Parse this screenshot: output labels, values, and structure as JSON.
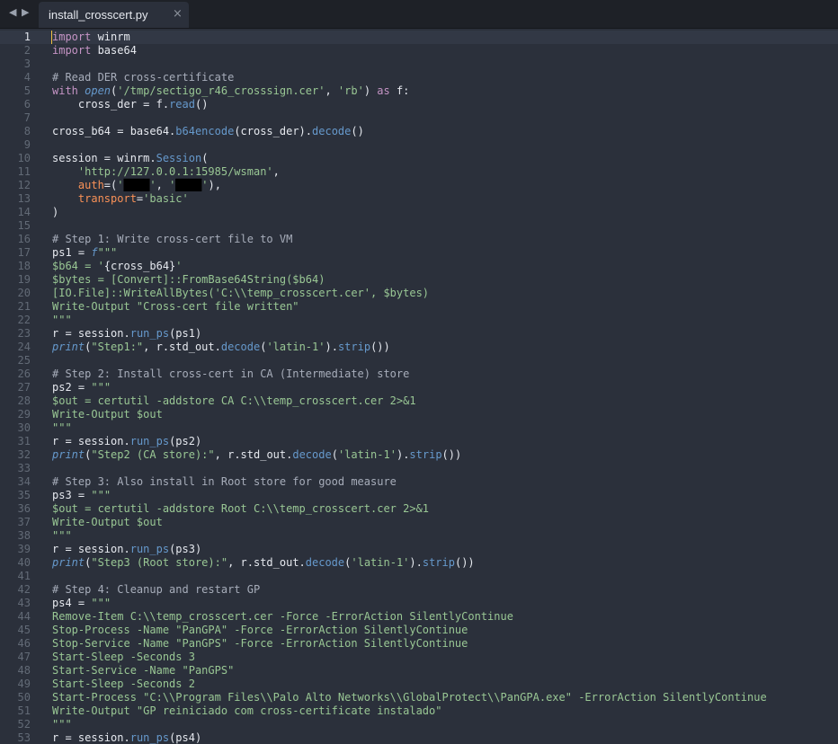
{
  "window": {
    "tab_title": "install_crosscert.py",
    "tab_close": "×",
    "nav_back": "◀",
    "nav_forward": "▶"
  },
  "editor": {
    "active_line": 1,
    "lines": [
      [
        [
          "k",
          "import"
        ],
        [
          "n",
          " winrm"
        ]
      ],
      [
        [
          "k",
          "import"
        ],
        [
          "n",
          " base64"
        ]
      ],
      [],
      [
        [
          "c",
          "# Read DER cross-certificate"
        ]
      ],
      [
        [
          "k",
          "with "
        ],
        [
          "b",
          "open"
        ],
        [
          "n",
          "("
        ],
        [
          "s",
          "'/tmp/sectigo_r46_crosssign.cer'"
        ],
        [
          "n",
          ", "
        ],
        [
          "s",
          "'rb'"
        ],
        [
          "n",
          ") "
        ],
        [
          "k",
          "as"
        ],
        [
          "n",
          " f:"
        ]
      ],
      [
        [
          "n",
          "    cross_der "
        ],
        [
          "o",
          "="
        ],
        [
          "n",
          " f."
        ],
        [
          "f",
          "read"
        ],
        [
          "n",
          "()"
        ]
      ],
      [],
      [
        [
          "n",
          "cross_b64 "
        ],
        [
          "o",
          "="
        ],
        [
          "n",
          " base64."
        ],
        [
          "f",
          "b64encode"
        ],
        [
          "n",
          "(cross_der)."
        ],
        [
          "f",
          "decode"
        ],
        [
          "n",
          "()"
        ]
      ],
      [],
      [
        [
          "n",
          "session "
        ],
        [
          "o",
          "="
        ],
        [
          "n",
          " winrm."
        ],
        [
          "f",
          "Session"
        ],
        [
          "n",
          "("
        ]
      ],
      [
        [
          "s",
          "    'http://127.0.0.1:15985/wsman'"
        ],
        [
          "n",
          ","
        ]
      ],
      [
        [
          "p",
          "    auth"
        ],
        [
          "o",
          "="
        ],
        [
          "n",
          "("
        ],
        [
          "s",
          "'"
        ],
        [
          "r",
          "████"
        ],
        [
          "s",
          "'"
        ],
        [
          "n",
          ", "
        ],
        [
          "s",
          "'"
        ],
        [
          "r",
          "████"
        ],
        [
          "s",
          "'"
        ],
        [
          "n",
          "),"
        ]
      ],
      [
        [
          "p",
          "    transport"
        ],
        [
          "o",
          "="
        ],
        [
          "s",
          "'basic'"
        ]
      ],
      [
        [
          "n",
          ")"
        ]
      ],
      [],
      [
        [
          "c",
          "# Step 1: Write cross-cert file to VM"
        ]
      ],
      [
        [
          "n",
          "ps1 "
        ],
        [
          "o",
          "="
        ],
        [
          "n",
          " "
        ],
        [
          "b",
          "f"
        ],
        [
          "s",
          "\"\"\""
        ]
      ],
      [
        [
          "s",
          "$b64 = '"
        ],
        [
          "n",
          "{cross_b64}"
        ],
        [
          "s",
          "'"
        ]
      ],
      [
        [
          "s",
          "$bytes = [Convert]::FromBase64String($b64)"
        ]
      ],
      [
        [
          "s",
          "[IO.File]::WriteAllBytes('C:\\\\temp_crosscert.cer', $bytes)"
        ]
      ],
      [
        [
          "s",
          "Write-Output \"Cross-cert file written\""
        ]
      ],
      [
        [
          "s",
          "\"\"\""
        ]
      ],
      [
        [
          "n",
          "r "
        ],
        [
          "o",
          "="
        ],
        [
          "n",
          " session."
        ],
        [
          "f",
          "run_ps"
        ],
        [
          "n",
          "(ps1)"
        ]
      ],
      [
        [
          "b",
          "print"
        ],
        [
          "n",
          "("
        ],
        [
          "s",
          "\"Step1:\""
        ],
        [
          "n",
          ", r.std_out."
        ],
        [
          "f",
          "decode"
        ],
        [
          "n",
          "("
        ],
        [
          "s",
          "'latin-1'"
        ],
        [
          "n",
          ")."
        ],
        [
          "f",
          "strip"
        ],
        [
          "n",
          "())"
        ]
      ],
      [],
      [
        [
          "c",
          "# Step 2: Install cross-cert in CA (Intermediate) store"
        ]
      ],
      [
        [
          "n",
          "ps2 "
        ],
        [
          "o",
          "="
        ],
        [
          "s",
          " \"\"\""
        ]
      ],
      [
        [
          "s",
          "$out = certutil -addstore CA C:\\\\temp_crosscert.cer 2>&1"
        ]
      ],
      [
        [
          "s",
          "Write-Output $out"
        ]
      ],
      [
        [
          "s",
          "\"\"\""
        ]
      ],
      [
        [
          "n",
          "r "
        ],
        [
          "o",
          "="
        ],
        [
          "n",
          " session."
        ],
        [
          "f",
          "run_ps"
        ],
        [
          "n",
          "(ps2)"
        ]
      ],
      [
        [
          "b",
          "print"
        ],
        [
          "n",
          "("
        ],
        [
          "s",
          "\"Step2 (CA store):\""
        ],
        [
          "n",
          ", r.std_out."
        ],
        [
          "f",
          "decode"
        ],
        [
          "n",
          "("
        ],
        [
          "s",
          "'latin-1'"
        ],
        [
          "n",
          ")."
        ],
        [
          "f",
          "strip"
        ],
        [
          "n",
          "())"
        ]
      ],
      [],
      [
        [
          "c",
          "# Step 3: Also install in Root store for good measure"
        ]
      ],
      [
        [
          "n",
          "ps3 "
        ],
        [
          "o",
          "="
        ],
        [
          "s",
          " \"\"\""
        ]
      ],
      [
        [
          "s",
          "$out = certutil -addstore Root C:\\\\temp_crosscert.cer 2>&1"
        ]
      ],
      [
        [
          "s",
          "Write-Output $out"
        ]
      ],
      [
        [
          "s",
          "\"\"\""
        ]
      ],
      [
        [
          "n",
          "r "
        ],
        [
          "o",
          "="
        ],
        [
          "n",
          " session."
        ],
        [
          "f",
          "run_ps"
        ],
        [
          "n",
          "(ps3)"
        ]
      ],
      [
        [
          "b",
          "print"
        ],
        [
          "n",
          "("
        ],
        [
          "s",
          "\"Step3 (Root store):\""
        ],
        [
          "n",
          ", r.std_out."
        ],
        [
          "f",
          "decode"
        ],
        [
          "n",
          "("
        ],
        [
          "s",
          "'latin-1'"
        ],
        [
          "n",
          ")."
        ],
        [
          "f",
          "strip"
        ],
        [
          "n",
          "())"
        ]
      ],
      [],
      [
        [
          "c",
          "# Step 4: Cleanup and restart GP"
        ]
      ],
      [
        [
          "n",
          "ps4 "
        ],
        [
          "o",
          "="
        ],
        [
          "s",
          " \"\"\""
        ]
      ],
      [
        [
          "s",
          "Remove-Item C:\\\\temp_crosscert.cer -Force -ErrorAction SilentlyContinue"
        ]
      ],
      [
        [
          "s",
          "Stop-Process -Name \"PanGPA\" -Force -ErrorAction SilentlyContinue"
        ]
      ],
      [
        [
          "s",
          "Stop-Service -Name \"PanGPS\" -Force -ErrorAction SilentlyContinue"
        ]
      ],
      [
        [
          "s",
          "Start-Sleep -Seconds 3"
        ]
      ],
      [
        [
          "s",
          "Start-Service -Name \"PanGPS\""
        ]
      ],
      [
        [
          "s",
          "Start-Sleep -Seconds 2"
        ]
      ],
      [
        [
          "s",
          "Start-Process \"C:\\\\Program Files\\\\Palo Alto Networks\\\\GlobalProtect\\\\PanGPA.exe\" -ErrorAction SilentlyContinue"
        ]
      ],
      [
        [
          "s",
          "Write-Output \"GP reiniciado com cross-certificate instalado\""
        ]
      ],
      [
        [
          "s",
          "\"\"\""
        ]
      ],
      [
        [
          "n",
          "r "
        ],
        [
          "o",
          "="
        ],
        [
          "n",
          " session."
        ],
        [
          "f",
          "run_ps"
        ],
        [
          "n",
          "(ps4)"
        ]
      ]
    ]
  }
}
